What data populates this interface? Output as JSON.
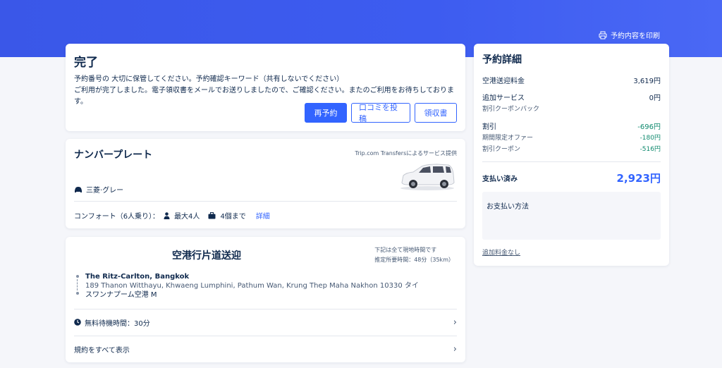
{
  "header": {
    "print_label": "予約内容を印刷"
  },
  "status": {
    "title": "完了",
    "line1": "予約番号の 大切に保管してください。予約確認キーワード（共有しないでください）",
    "line2": "ご利用が完了しました。電子領収書をメールでお送りしましたので、ご確認ください。またのご利用をお待ちしております。",
    "buttons": {
      "rebook": "再予約",
      "review": "口コミを投稿",
      "receipt": "領収書"
    }
  },
  "vehicle": {
    "title": "ナンバープレート",
    "provider": "Trip.com Transfersによるサービス提供",
    "car_name": "三菱·グレー",
    "class_label": "コンフォート（6人乗り）：",
    "passengers": "最大4人",
    "luggage": "4個まで",
    "details_link": "詳細"
  },
  "transfer": {
    "title": "空港行片道送迎",
    "note1": "下記は全て現地時間です",
    "note2": "推定所要時間：48分（35km）",
    "from_name": "The Ritz-Carlton, Bangkok",
    "from_address": "189 Thanon Witthayu, Khwaeng Lumphini, Pathum Wan, Krung Thep Maha Nakhon 10330 タイ",
    "to_name": "スワンナプーム空港 M",
    "wait_label": "無料待機時間：30分",
    "terms_label": "規約をすべて表示"
  },
  "summary": {
    "title": "予約詳細",
    "fare_label": "空港送迎料金",
    "fare_value": "3,619円",
    "addon_label": "追加サービス",
    "addon_value": "0円",
    "addon_sub": "割引クーポンバック",
    "discount_label": "割引",
    "discount_value": "-696円",
    "limited_label": "期間限定オファー",
    "limited_value": "-180円",
    "coupon_label": "割引クーポン",
    "coupon_value": "-516円",
    "paid_label": "支払い済み",
    "paid_value": "2,923円",
    "payment_method_label": "お支払い方法",
    "footer_link": "追加料金なし"
  },
  "colors": {
    "brand": "#3264ff",
    "hero": "#3d5cf0",
    "discount": "#0f8a6e"
  }
}
